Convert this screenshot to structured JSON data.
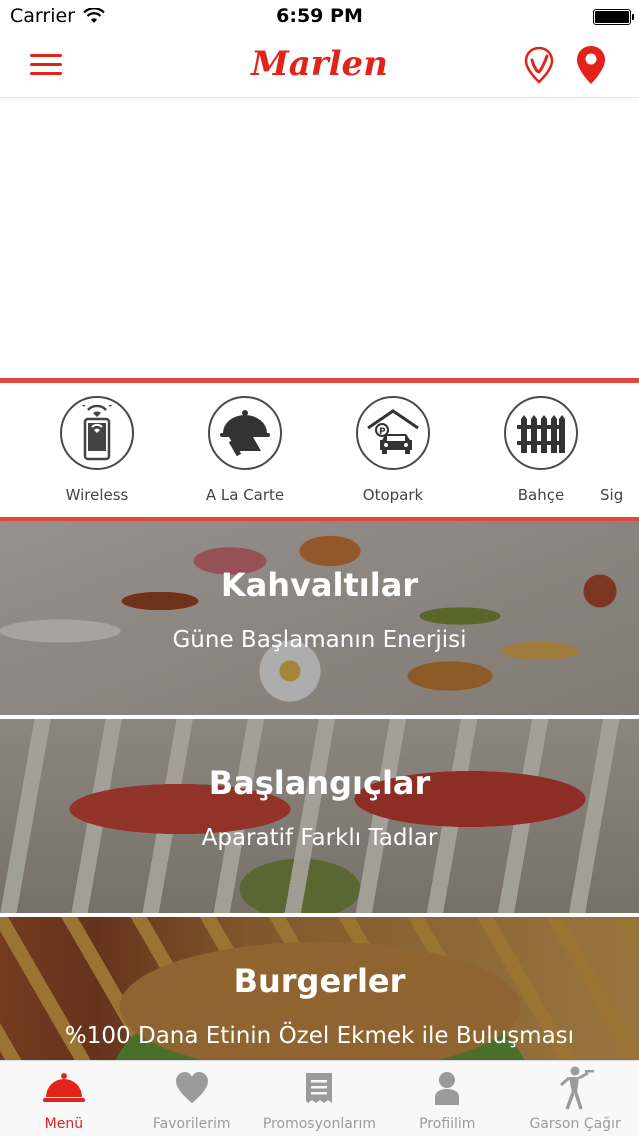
{
  "status_bar": {
    "carrier": "Carrier",
    "time": "6:59 PM"
  },
  "header": {
    "logo": "Marlen",
    "menu_icon": "hamburger-menu-icon",
    "route_icon": "route-pin-icon",
    "location_icon": "map-pin-icon"
  },
  "features": [
    {
      "label": "Wireless",
      "icon": "wireless-phone-icon"
    },
    {
      "label": "A La Carte",
      "icon": "serving-cloche-icon"
    },
    {
      "label": "Otopark",
      "icon": "parking-garage-icon"
    },
    {
      "label": "Bahçe",
      "icon": "garden-fence-icon"
    },
    {
      "label": "Sig",
      "icon": ""
    }
  ],
  "categories": [
    {
      "title": "Kahvaltılar",
      "subtitle": "Güne Başlamanın Enerjisi"
    },
    {
      "title": "Başlangıçlar",
      "subtitle": "Aparatif Farklı Tadlar"
    },
    {
      "title": "Burgerler",
      "subtitle": "%100 Dana Etinin Özel Ekmek ile Buluşması"
    }
  ],
  "tabs": [
    {
      "label": "Menü",
      "icon": "serving-bell-icon",
      "active": true
    },
    {
      "label": "Favorilerim",
      "icon": "heart-icon",
      "active": false
    },
    {
      "label": "Promosyonlarım",
      "icon": "receipt-icon",
      "active": false
    },
    {
      "label": "Profiilim",
      "icon": "user-icon",
      "active": false
    },
    {
      "label": "Garson Çağır",
      "icon": "waiter-icon",
      "active": false
    }
  ],
  "colors": {
    "accent": "#e2231a",
    "strip": "#e2473f",
    "tab_inactive": "#9b9b9b"
  }
}
